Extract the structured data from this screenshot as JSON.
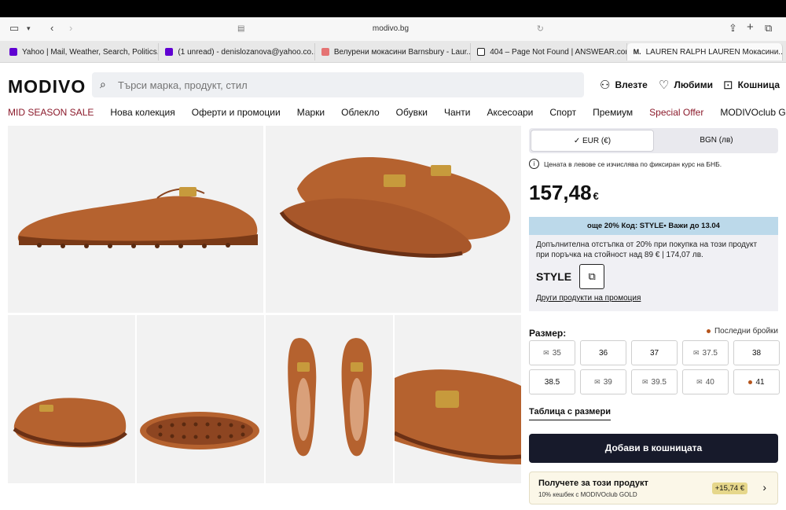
{
  "browser": {
    "url": "modivo.bg",
    "tabs": [
      {
        "title": "Yahoo | Mail, Weather, Search, Politics...",
        "color": "#6001d2"
      },
      {
        "title": "(1 unread) - denislozanova@yahoo.co....",
        "color": "#6001d2"
      },
      {
        "title": "Велурени мокасини Barnsbury - Laur...",
        "color": "#e57373"
      },
      {
        "title": "404 – Page Not Found | ANSWEAR.com",
        "color": "#222222"
      },
      {
        "title": "LAUREN RALPH LAUREN Мокасини...",
        "color": "#222222"
      }
    ],
    "tab_icons": {
      "sidebar": "sidebar-icon",
      "back": "back-icon",
      "forward": "forward-icon",
      "share": "share-icon",
      "new_tab": "plus-icon",
      "tabs": "tabs-icon"
    }
  },
  "header": {
    "logo": "MODIVO",
    "search_placeholder": "Търси марка, продукт, стил",
    "login": "Влезте",
    "favorites": "Любими",
    "cart": "Кошница"
  },
  "nav": [
    "MID SEASON SALE",
    "Нова колекция",
    "Оферти и промоции",
    "Марки",
    "Облекло",
    "Обувки",
    "Чанти",
    "Аксесоари",
    "Спорт",
    "Премиум",
    "Special Offer",
    "MODIVOclub GOLD"
  ],
  "currency": {
    "selected": "EUR (€)",
    "other": "BGN (лв)"
  },
  "info_note": "Цената в левове се изчислява по фиксиран курс на БНБ.",
  "price": {
    "value": "157,48",
    "currency": "€"
  },
  "promo": {
    "bar": "още 20% Код: STYLE• Важи до 13.04",
    "text": "Допълнителна отстъпка от 20% при покупка на този продукт при поръчка на стойност над 89 € | 174,07 лв.",
    "code": "STYLE",
    "link": "Други продукти на промоция"
  },
  "sizes": {
    "label": "Размер:",
    "last_pieces": "Последни бройки",
    "options": [
      {
        "size": "35",
        "available": false
      },
      {
        "size": "36",
        "available": true
      },
      {
        "size": "37",
        "available": true
      },
      {
        "size": "37.5",
        "available": false
      },
      {
        "size": "38",
        "available": true
      },
      {
        "size": "38.5",
        "available": true
      },
      {
        "size": "39",
        "available": false
      },
      {
        "size": "39.5",
        "available": false
      },
      {
        "size": "40",
        "available": false
      },
      {
        "size": "41",
        "available": true,
        "last": true
      }
    ],
    "table_link": "Таблица с размери"
  },
  "add_to_cart": "Добави в кошницата",
  "club": {
    "title": "Получете за този продукт",
    "subtitle": "10% кешбек с MODIVOclub GOLD",
    "badge": "+15,74 €"
  },
  "colors": {
    "leather": "#b5622f",
    "leather_dark": "#7a3a17",
    "sale": "#8b1a2b",
    "primary_button": "#171a2b"
  }
}
